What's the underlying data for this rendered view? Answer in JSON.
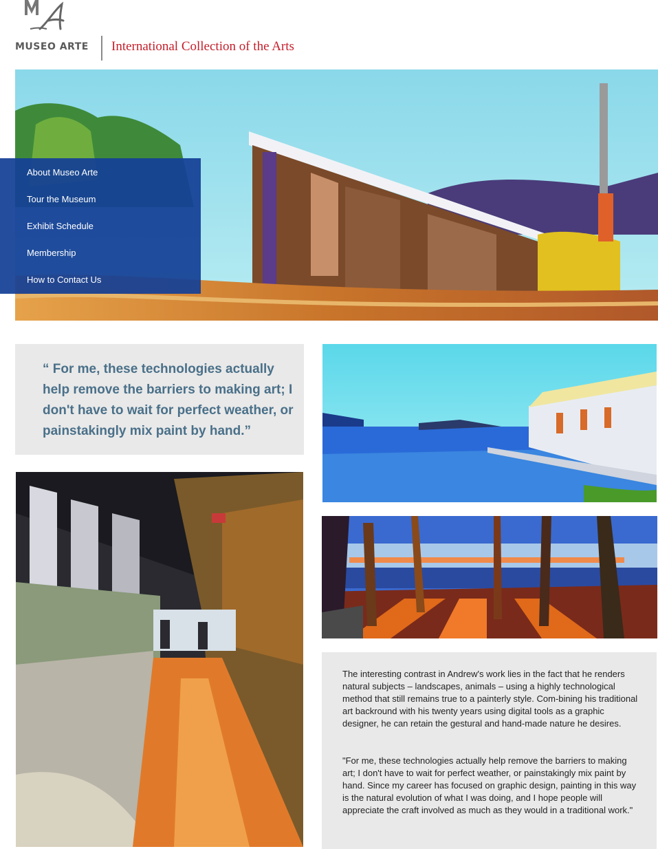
{
  "header": {
    "logo_word": "MUSEO ARTE",
    "tagline": "International Collection of the Arts"
  },
  "nav": {
    "items": [
      {
        "label": "About Museo Arte"
      },
      {
        "label": "Tour the Museum"
      },
      {
        "label": "Exhibit Schedule"
      },
      {
        "label": "Membership"
      },
      {
        "label": "How to Contact Us"
      }
    ]
  },
  "quote": {
    "text": "“ For me, these technologies actually help remove the barriers to making art; I don't have to wait for perfect weather, or painstakingly mix paint by hand.”"
  },
  "article": {
    "paragraph1": "The interesting contrast in Andrew's work lies in the fact that he renders natural subjects – landscapes, animals – using a highly technological method that still remains true to a painterly style. Com-bining his traditional art backround with his twenty years using digital tools as a graphic designer, he can retain the gestural and hand-made nature he desires.",
    "paragraph2": "\"For me, these technologies actually help remove the barriers to making art; I don't have to wait for perfect weather, or painstakingly mix paint by hand. Since my career has focused on graphic design, painting in this way is the natural evolution of what I was doing, and I hope people will appreciate the craft involved as much as they would in a traditional work.\""
  },
  "colors": {
    "brand_red": "#c41e2a",
    "nav_blue": "#1440a0",
    "quote_teal": "#4a7089",
    "panel_gray": "#e9e9e9"
  }
}
